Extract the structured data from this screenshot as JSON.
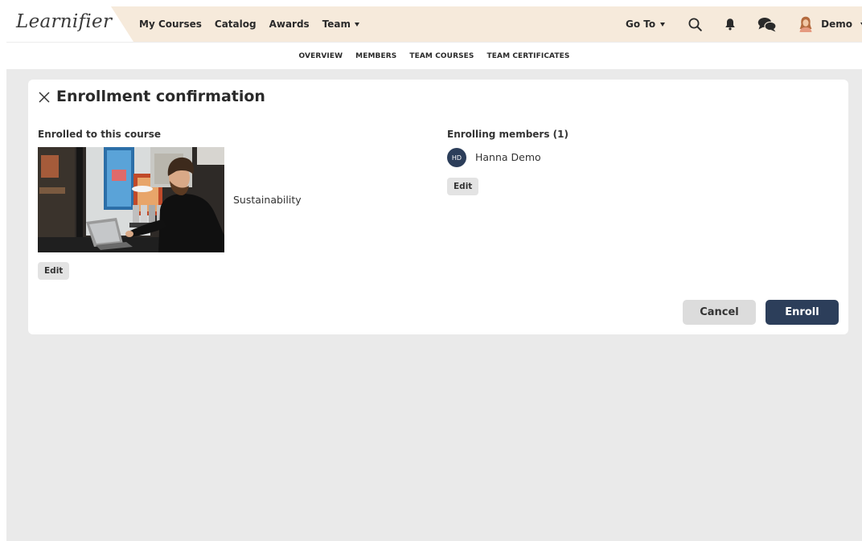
{
  "brand": {
    "logo_text": "Learnifier"
  },
  "nav": {
    "items": [
      {
        "label": "My Courses"
      },
      {
        "label": "Catalog"
      },
      {
        "label": "Awards"
      },
      {
        "label": "Team",
        "has_dropdown": true
      }
    ],
    "goto_label": "Go To",
    "user_label": "Demo",
    "icons": [
      "search-icon",
      "bell-icon",
      "chat-icon",
      "avatar-icon"
    ]
  },
  "subnav": {
    "items": [
      {
        "label": "OVERVIEW"
      },
      {
        "label": "MEMBERS"
      },
      {
        "label": "TEAM COURSES"
      },
      {
        "label": "TEAM CERTIFICATES"
      }
    ]
  },
  "dialog": {
    "title": "Enrollment confirmation",
    "course_section_label": "Enrolled to this course",
    "course_name": "Sustainability",
    "course_edit_label": "Edit",
    "members_section_label": "Enrolling members (1)",
    "members": [
      {
        "initials": "HD",
        "name": "Hanna Demo"
      }
    ],
    "members_edit_label": "Edit",
    "cancel_label": "Cancel",
    "enroll_label": "Enroll"
  },
  "colors": {
    "nav_background": "#f6eadb",
    "page_background": "#eaeaea",
    "primary": "#2c3e5a",
    "secondary_button": "#dcdcdc"
  }
}
